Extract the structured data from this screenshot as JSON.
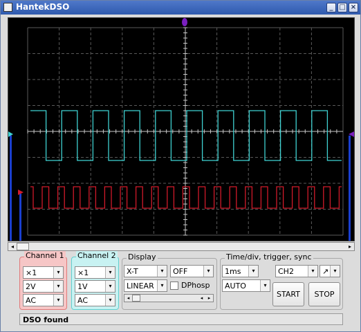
{
  "window": {
    "title": "HantekDSO"
  },
  "titlebar_buttons": {
    "minimize": "_",
    "maximize": "□",
    "close": "×"
  },
  "colors": {
    "ch1_trace": "#d21a2a",
    "ch2_trace": "#3fd2d2",
    "grid": "#5a5a5a",
    "axis": "#c8c8c8",
    "trigger_marker": "#7a1fbf"
  },
  "scope": {
    "ch2_signal": "square wave, 10 periods across screen",
    "ch1_signal": "narrow pulse train, ~20 periods across screen"
  },
  "channel1": {
    "legend": "Channel 1",
    "probe": "×1",
    "volts": "2V",
    "coupling": "AC"
  },
  "channel2": {
    "legend": "Channel 2",
    "probe": "×1",
    "volts": "1V",
    "coupling": "AC"
  },
  "display": {
    "legend": "Display",
    "mode": "X-T",
    "math": "OFF",
    "scale": "LINEAR",
    "dphosp_label": "DPhosp"
  },
  "timebase": {
    "legend": "Time/div, trigger, sync",
    "timediv": "1ms",
    "trigger_source": "CH2",
    "slope": "↗",
    "trigger_mode": "AUTO",
    "start_label": "START",
    "stop_label": "STOP"
  },
  "status": {
    "text": "DSO found"
  },
  "icons": {
    "dropdown": "▾",
    "left_arrow": "◂",
    "right_arrow": "▸"
  }
}
